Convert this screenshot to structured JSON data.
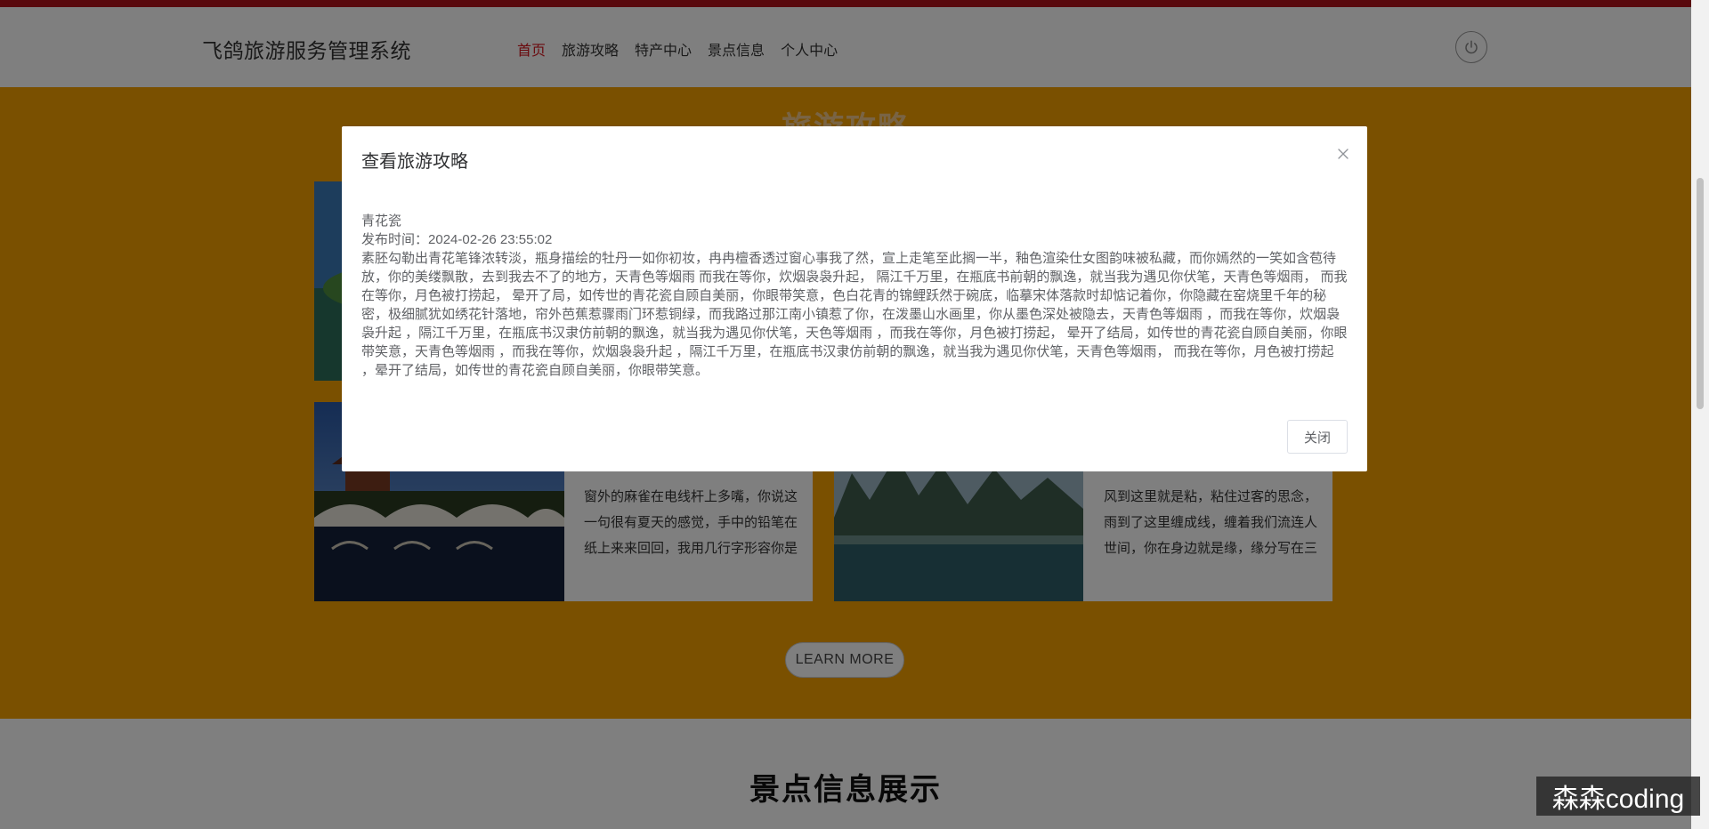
{
  "header": {
    "brand": "飞鸽旅游服务管理系统",
    "nav": [
      "首页",
      "旅游攻略",
      "特产中心",
      "景点信息",
      "个人中心"
    ],
    "active_index": 0
  },
  "section": {
    "title": "旅游攻略",
    "cards": [
      {
        "text": "窗外的麻雀在电线杆上多嘴，你说这一句很有夏天的感觉，手中的铅笔在纸上来来回回，我用几行字形容你是"
      },
      {
        "text": "风到这里就是粘，粘住过客的思念，雨到了这里缠成线，缠着我们流连人世间，你在身边就是缘，缘分写在三"
      }
    ],
    "learn_more": "LEARN MORE"
  },
  "lower": {
    "title": "景点信息展示"
  },
  "modal": {
    "title": "查看旅游攻略",
    "article_title": "青花瓷",
    "publish_label": "发布时间：",
    "publish_time": "2024-02-26 23:55:02",
    "content": "素胚勾勒出青花笔锋浓转淡，瓶身描绘的牡丹一如你初妆，冉冉檀香透过窗心事我了然，宣上走笔至此搁一半，釉色渲染仕女图韵味被私藏，而你嫣然的一笑如含苞待放，你的美缕飘散，去到我去不了的地方，天青色等烟雨 而我在等你，炊烟袅袅升起， 隔江千万里，在瓶底书前朝的飘逸，就当我为遇见你伏笔，天青色等烟雨， 而我在等你，月色被打捞起， 晕开了局，如传世的青花瓷自顾自美丽，你眼带笑意，色白花青的锦鲤跃然于碗底，临摹宋体落款时却惦记着你，你隐藏在窑烧里千年的秘密，极细腻犹如绣花针落地，帘外芭蕉惹骤雨门环惹铜绿，而我路过那江南小镇惹了你，在泼墨山水画里，你从墨色深处被隐去，天青色等烟雨 ，而我在等你，炊烟袅袅升起 ，隔江千万里，在瓶底书汉隶仿前朝的飘逸，就当我为遇见你伏笔，天色等烟雨 ，而我在等你，月色被打捞起， 晕开了结局，如传世的青花瓷自顾自美丽，你眼带笑意，天青色等烟雨 ，而我在等你，炊烟袅袅升起 ，隔江千万里，在瓶底书汉隶仿前朝的飘逸，就当我为遇见你伏笔，天青色等烟雨， 而我在等你，月色被打捞起 ，晕开了结局，如传世的青花瓷自顾自美丽，你眼带笑意。",
    "close_label": "关闭"
  },
  "watermark": "森森coding",
  "colors": {
    "accent_red": "#d4141d",
    "orange": "#f5a100"
  }
}
